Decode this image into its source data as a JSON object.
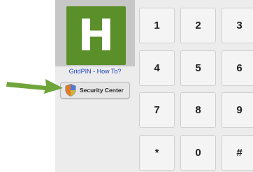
{
  "app": {
    "logo_letter": "H",
    "howto_link": "GridPIN - How To?",
    "security_button_label": "Security Center"
  },
  "keypad": {
    "keys": [
      "1",
      "2",
      "3",
      "4",
      "5",
      "6",
      "7",
      "8",
      "9",
      "*",
      "0",
      "#"
    ]
  },
  "icons": {
    "logo": "h-logo-icon",
    "security": "shield-icon",
    "pointer": "arrow-right-icon"
  },
  "colors": {
    "logo_green": "#5a8f2a",
    "link_blue": "#1a3fb5",
    "arrow_green": "#6fa53a"
  }
}
